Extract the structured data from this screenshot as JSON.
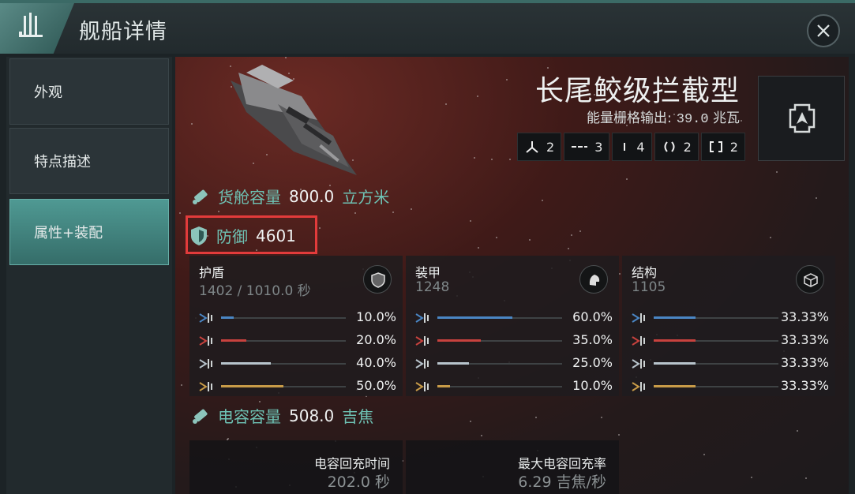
{
  "window": {
    "title": "舰船详情"
  },
  "icons": {
    "logo": "ship-fleet-icon",
    "close": "close-icon"
  },
  "sidebar": {
    "items": [
      {
        "label": "外观",
        "active": false
      },
      {
        "label": "特点描述",
        "active": false
      },
      {
        "label": "属性+装配",
        "active": true
      }
    ]
  },
  "ship": {
    "name": "长尾鲛级拦截型",
    "power_label": "能量栅格输出:",
    "power_value": "39.0",
    "power_unit": "兆瓦",
    "slots": [
      {
        "icon": "turret-hardpoint-icon",
        "count": "2"
      },
      {
        "icon": "high-slot-icon",
        "count": "3"
      },
      {
        "icon": "mid-slot-icon",
        "count": "4"
      },
      {
        "icon": "low-slot-icon",
        "count": "2"
      },
      {
        "icon": "rig-slot-icon",
        "count": "2"
      }
    ]
  },
  "cargo": {
    "label": "货舱容量",
    "value": "800.0",
    "unit": "立方米"
  },
  "defense": {
    "label": "防御",
    "value": "4601"
  },
  "resist": {
    "colors": {
      "em": "#4a86c4",
      "thermal": "#c8423e",
      "kinetic": "#b8c4cc",
      "explosive": "#c89b48"
    },
    "shield": {
      "title": "护盾",
      "sub": "1402 / 1010.0 秒",
      "values": [
        0.1,
        0.2,
        0.4,
        0.5
      ],
      "labels": [
        "10.0%",
        "20.0%",
        "40.0%",
        "50.0%"
      ]
    },
    "armor": {
      "title": "装甲",
      "sub": "1248",
      "values": [
        0.6,
        0.35,
        0.25,
        0.1
      ],
      "labels": [
        "60.0%",
        "35.0%",
        "25.0%",
        "10.0%"
      ]
    },
    "structure": {
      "title": "结构",
      "sub": "1105",
      "values": [
        0.3333,
        0.3333,
        0.3333,
        0.3333
      ],
      "labels": [
        "33.33%",
        "33.33%",
        "33.33%",
        "33.33%"
      ]
    }
  },
  "capacitor": {
    "label": "电容容量",
    "value": "508.0",
    "unit": "吉焦",
    "recharge_label": "电容回充时间",
    "recharge_value": "202.0 秒",
    "peak_label": "最大电容回充率",
    "peak_value": "6.29 吉焦/秒"
  }
}
